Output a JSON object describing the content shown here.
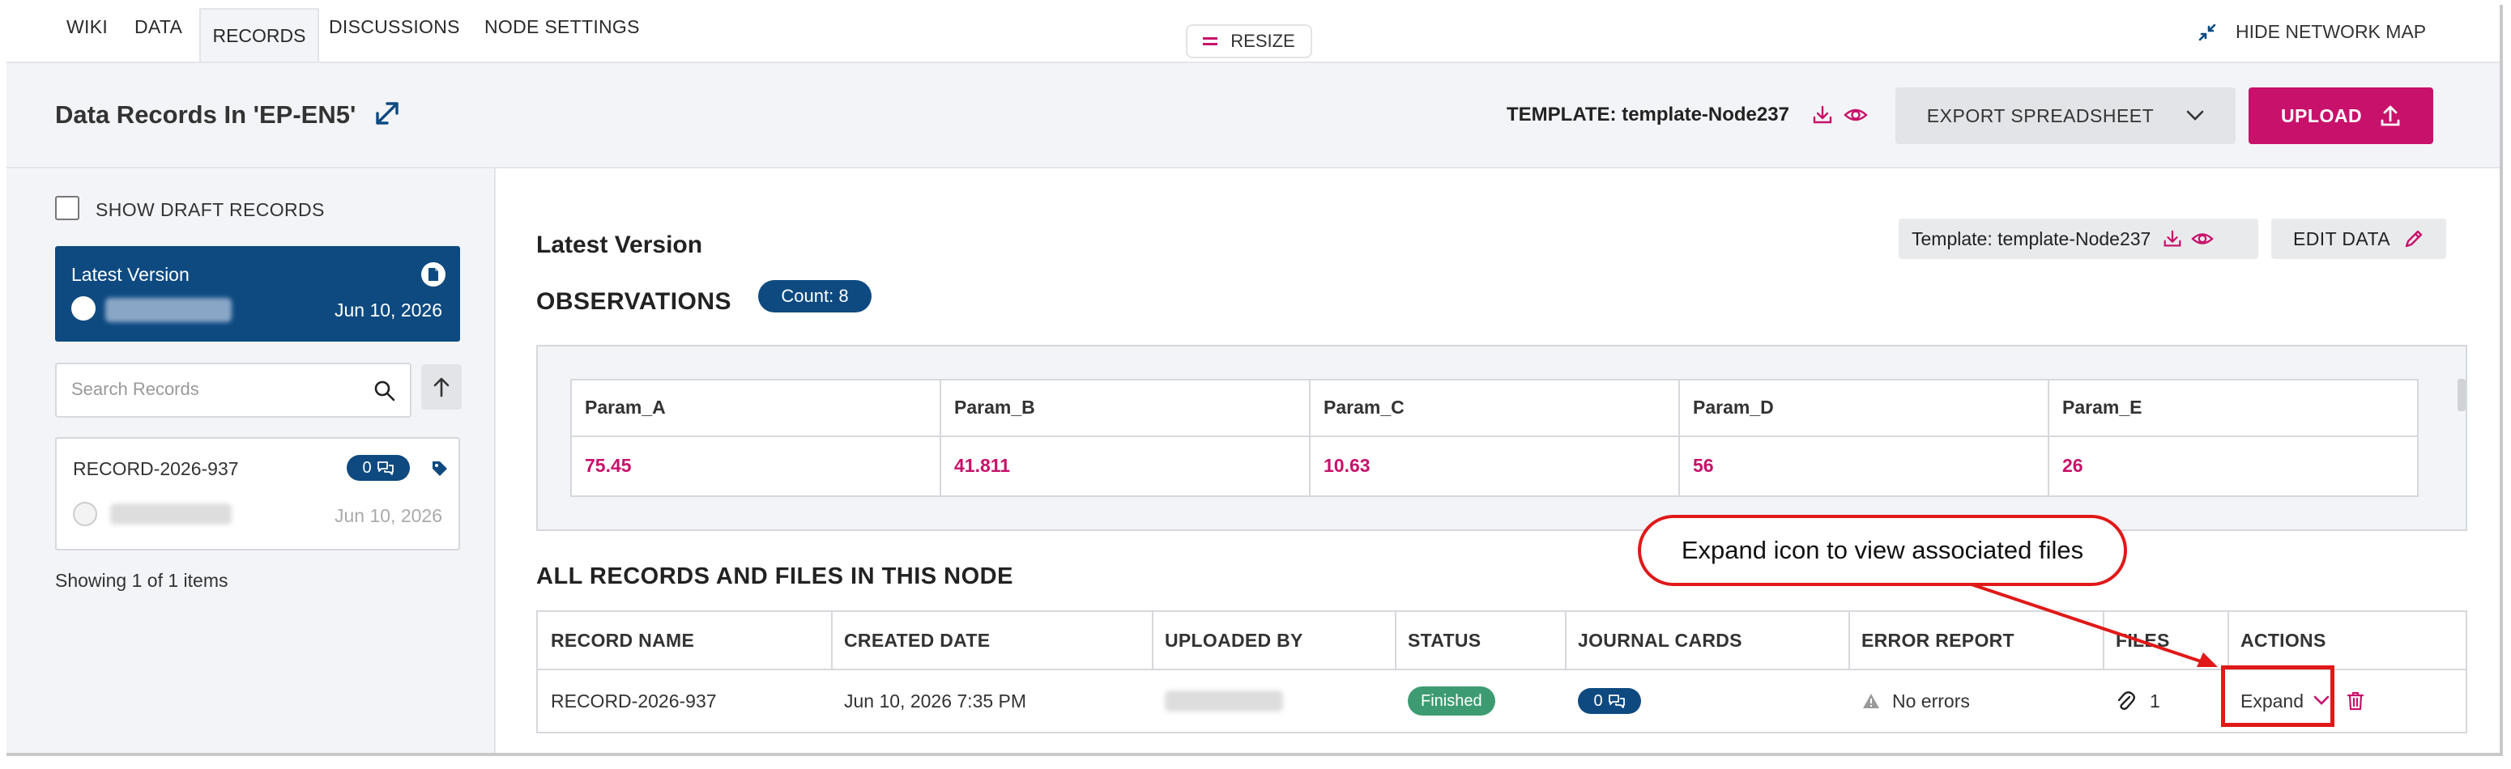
{
  "nav": {
    "tabs": [
      "WIKI",
      "DATA",
      "RECORDS",
      "DISCUSSIONS",
      "NODE SETTINGS"
    ],
    "active_tab": "RECORDS",
    "resize_label": "RESIZE",
    "hide_map_label": "HIDE NETWORK MAP"
  },
  "header": {
    "title": "Data Records In 'EP-EN5'",
    "template_prefix": "TEMPLATE:",
    "template_name": "template-Node237",
    "export_label": "EXPORT SPREADSHEET",
    "upload_label": "UPLOAD"
  },
  "sidebar": {
    "show_draft_label": "SHOW DRAFT RECORDS",
    "latest_card": {
      "title": "Latest Version",
      "date": "Jun 10, 2026"
    },
    "search_placeholder": "Search Records",
    "record_card": {
      "name": "RECORD-2026-937",
      "comments": "0",
      "date": "Jun 10, 2026"
    },
    "showing_text": "Showing 1 of 1 items"
  },
  "main": {
    "latest_version_title": "Latest Version",
    "template_label": "Template: template-Node237",
    "edit_data_label": "EDIT DATA",
    "observations_title": "OBSERVATIONS",
    "count_label": "Count: 8",
    "observations": {
      "headers": [
        "Param_A",
        "Param_B",
        "Param_C",
        "Param_D",
        "Param_E"
      ],
      "values": [
        "75.45",
        "41.811",
        "10.63",
        "56",
        "26"
      ]
    },
    "all_records_title": "ALL RECORDS AND FILES IN THIS NODE",
    "records_table": {
      "headers": [
        "RECORD NAME",
        "CREATED DATE",
        "UPLOADED BY",
        "STATUS",
        "JOURNAL CARDS",
        "ERROR REPORT",
        "FILES",
        "ACTIONS"
      ],
      "row": {
        "record_name": "RECORD-2026-937",
        "created_date": "Jun 10, 2026 7:35 PM",
        "status": "Finished",
        "journal_cards": "0",
        "error_report": "No errors",
        "files": "1",
        "action_label": "Expand"
      }
    }
  },
  "annotation": {
    "callout_text": "Expand icon to view associated files"
  },
  "colors": {
    "accent": "#c8116a",
    "navy": "#0e4a80",
    "success": "#3d9b71",
    "annotation": "#e01919"
  }
}
